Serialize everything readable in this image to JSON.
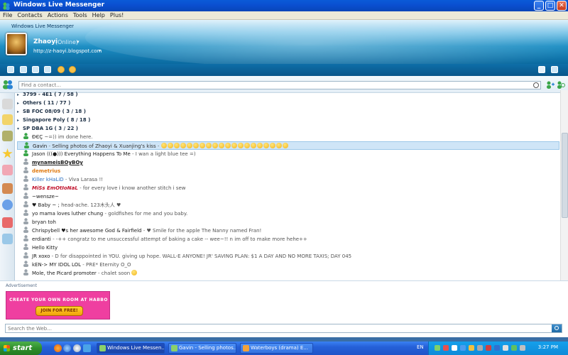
{
  "window": {
    "title": "Windows Live Messenger",
    "brand": "Windows Live Messenger"
  },
  "menu": [
    "File",
    "Contacts",
    "Actions",
    "Tools",
    "Help",
    "Plus!"
  ],
  "profile": {
    "name": "Zhaoyi",
    "status": "(Online)",
    "personal_message": "http://z-haoyi.blogspot.com"
  },
  "search": {
    "placeholder": "Find a contact..."
  },
  "groups": [
    {
      "label": "3799 - 4E1 ( 7 / 58 )"
    },
    {
      "label": "Others ( 11 / 77 )"
    },
    {
      "label": "SB FOC 08/09 ( 3 / 18 )"
    },
    {
      "label": "Singapore Poly ( 8 / 18 )"
    },
    {
      "label": "SP DBA 1G ( 3 / 22 )"
    }
  ],
  "contacts": [
    {
      "name": "ÐЄÇ",
      "message": "~=))      im done here."
    },
    {
      "name": "Gavin",
      "message": "Selling photos of Zhaoyi & Xuanjing's kiss",
      "emotes": 20
    },
    {
      "name": "Jason (((●))) Everything Happens To Me",
      "message": "I wan a light blue tee =)"
    },
    {
      "name": "mynameisBOyBOy",
      "message": ""
    },
    {
      "name": "demetrius",
      "message": ""
    },
    {
      "name": "Killer kHaLiD",
      "message": "Viva Larasa !!"
    },
    {
      "name": "MiSs EmOtIoNaL",
      "message": "for every love i know          another stitch i sew"
    },
    {
      "name": "~wensze~",
      "message": ""
    },
    {
      "name": "♥ Baby ~ ;",
      "message": "head-ache.                            123木头人 ♥"
    },
    {
      "name": "yo mama loves luther chung",
      "message": "goldfishes for me and you baby."
    },
    {
      "name": "bryan toh",
      "message": ""
    },
    {
      "name": "Chrispybell ♥s her awesome God & Fairfield",
      "message": "♥ Smile for the apple              The Nanny named Fran!"
    },
    {
      "name": "erdianti",
      "message": "-++ congratz to me unsuccessful attempt of baking a cake -- wee~!! n im off to make more hehe++"
    },
    {
      "name": "Hello Kitty",
      "message": ""
    },
    {
      "name": "JR  xoxo",
      "message": "D for disappointed in YOU. giving up hope.        WALL-E ANYONE!          JR' SAVING PLAN: $1 A DAY AND NO MORE TAXIS; DAY 045"
    },
    {
      "name": "kEN-> MY IDOL LOL",
      "message": "PRE*          Eternity                O_O"
    },
    {
      "name": "Mole, the Picard promoter",
      "message": "chalet soon"
    }
  ],
  "ad": {
    "label": "Advertisement",
    "line1": "CREATE YOUR OWN ROOM AT HABBO",
    "button": "JOIN FOR FREE!"
  },
  "web_search": {
    "placeholder": "Search the Web..."
  },
  "taskbar": {
    "start": "start",
    "tasks": [
      "Windows Live Messen...",
      "Gavin - Selling photos...",
      "Waterboys (drama) E..."
    ],
    "lang": "EN",
    "clock": "3:27 PM"
  },
  "colors": {
    "header_accent": "#1e8fc4",
    "selection": "#cfe5f7",
    "taskbar": "#2560d8",
    "start": "#2f8f2c",
    "ad": "#ef3fa0"
  }
}
